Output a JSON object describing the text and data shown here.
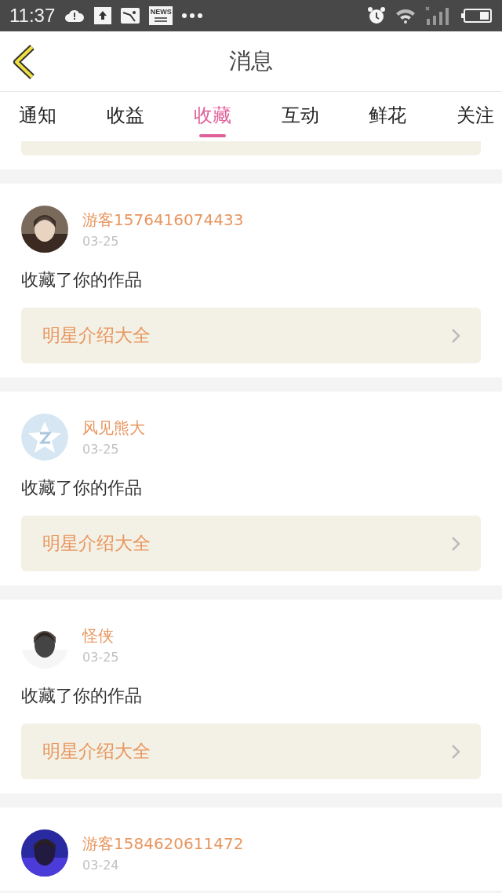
{
  "status_bar": {
    "time": "11:37",
    "news_label": "NEWS"
  },
  "header": {
    "title": "消息"
  },
  "tabs": [
    {
      "label": "通知",
      "selected": false
    },
    {
      "label": "收益",
      "selected": false
    },
    {
      "label": "收藏",
      "selected": true
    },
    {
      "label": "互动",
      "selected": false
    },
    {
      "label": "鲜花",
      "selected": false
    },
    {
      "label": "关注",
      "selected": false
    }
  ],
  "messages": [
    {
      "name": "游客1576416074433",
      "date": "03-25",
      "text": "收藏了你的作品",
      "work": "明星介绍大全"
    },
    {
      "avatar": {
        "kind": "default"
      },
      "name": "风见熊大",
      "date": "03-25",
      "text": "收藏了你的作品",
      "work": "明星介绍大全"
    },
    {
      "name": "怪侠",
      "date": "03-25",
      "text": "收藏了你的作品",
      "work": "明星介绍大全"
    },
    {
      "name": "游客1584620611472",
      "date": "03-24"
    }
  ]
}
